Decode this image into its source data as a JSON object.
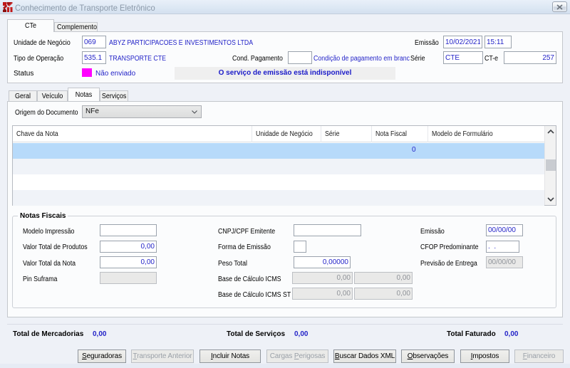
{
  "window": {
    "title": "Conhecimento de Transporte Eletrônico"
  },
  "tabs_main": {
    "cte": "CTe",
    "complemento": "Complemento"
  },
  "cte": {
    "unidade_label": "Unidade de Negócio",
    "unidade_code": "069",
    "unidade_name": "ABYZ PARTICIPACOES E INVESTIMENTOS LTDA",
    "emissao_label": "Emissão",
    "emissao_date": "10/02/2021",
    "emissao_time": "15:11",
    "tipo_label": "Tipo de Operação",
    "tipo_code": "535.1",
    "tipo_name": "TRANSPORTE CTE",
    "cond_label": "Cond. Pagamento",
    "cond_value": "",
    "cond_hint": "Condição de pagamento em branco",
    "serie_label": "Série",
    "serie_value": "CTE",
    "cte_label": "CT-e",
    "cte_value": "257",
    "status_label": "Status",
    "status_value": "Não enviado",
    "status_color": "#ff00ff",
    "status_message": "O serviço de emissão está indisponível"
  },
  "tabs_sub": {
    "geral": "Geral",
    "veiculo": "Veículo",
    "notas": "Notas",
    "servicos": "Serviços"
  },
  "notas": {
    "origem_label": "Origem do Documento",
    "origem_value": "NFe",
    "table": {
      "columns": [
        "Chave da Nota",
        "Unidade de Negócio",
        "Série",
        "Nota Fiscal",
        "Modelo de Formulário"
      ],
      "selected_row": {
        "nota_fiscal": "0"
      }
    },
    "group_title": "Notas Fiscais",
    "fields": {
      "modelo": {
        "label": "Modelo Impressão",
        "value": ""
      },
      "valor_produtos": {
        "label": "Valor Total de Produtos",
        "value": "0,00"
      },
      "valor_nota": {
        "label": "Valor Total da Nota",
        "value": "0,00"
      },
      "pin": {
        "label": "Pin Suframa",
        "value": ""
      },
      "cnpj": {
        "label": "CNPJ/CPF Emitente",
        "value": ""
      },
      "forma": {
        "label": "Forma de Emissão",
        "value": ""
      },
      "peso": {
        "label": "Peso Total",
        "value": "0,00000"
      },
      "base_icms": {
        "label": "Base de Cálculo ICMS",
        "value1": "0,00",
        "value2": "0,00"
      },
      "base_icms_st": {
        "label": "Base de Cálculo ICMS ST",
        "value1": "0,00",
        "value2": "0,00"
      },
      "emissao": {
        "label": "Emissão",
        "value": "00/00/00"
      },
      "cfop": {
        "label": "CFOP Predominante",
        "value": ".  ."
      },
      "previsao": {
        "label": "Previsão de Entrega",
        "value": "00/00/00"
      }
    }
  },
  "totals": {
    "mercadorias": {
      "label": "Total de Mercadorias",
      "value": "0,00"
    },
    "servicos": {
      "label": "Total de Serviços",
      "value": "0,00"
    },
    "faturado": {
      "label": "Total Faturado",
      "value": "0,00"
    }
  },
  "buttons": [
    {
      "label": "Seguradoras",
      "accel": "S",
      "enabled": true
    },
    {
      "label": "Transporte Anterior",
      "accel": "T",
      "enabled": false
    },
    {
      "label": "Incluir Notas",
      "accel": "I",
      "enabled": true
    },
    {
      "label": "Cargas Perigosas",
      "accel": "P",
      "enabled": false
    },
    {
      "label": "Buscar Dados XML",
      "accel": "B",
      "enabled": true
    },
    {
      "label": "Observações",
      "accel": "O",
      "enabled": true
    },
    {
      "label": "Impostos",
      "accel": "I",
      "enabled": true
    },
    {
      "label": "Financeiro",
      "accel": "F",
      "enabled": false
    }
  ]
}
